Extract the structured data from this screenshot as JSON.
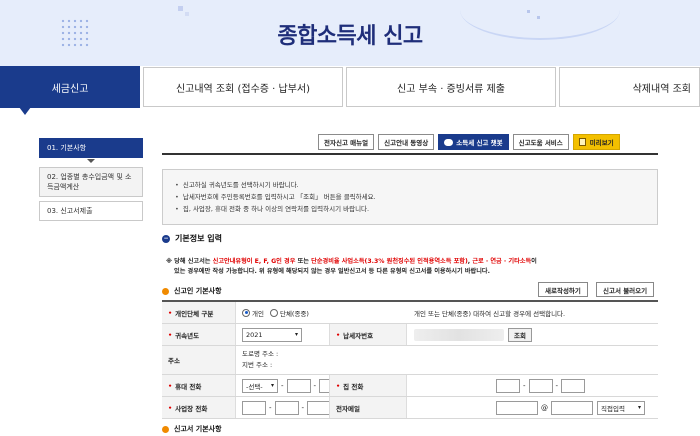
{
  "header": {
    "title": "종합소득세 신고"
  },
  "nav": {
    "tabs": [
      {
        "label": "세금신고",
        "active": true
      },
      {
        "label": "신고내역 조회 (접수증 · 납부서)",
        "active": false
      },
      {
        "label": "신고 부속 · 증빙서류 제출",
        "active": false
      },
      {
        "label": "삭제내역 조회",
        "active": false
      }
    ]
  },
  "steps": [
    {
      "label": "01. 기본사항",
      "state": "active"
    },
    {
      "label": "02. 업종별 총수입금액 및 소득금액계산",
      "state": "normal"
    },
    {
      "label": "03. 신고서제출",
      "state": "current"
    }
  ],
  "toolbar": {
    "manual": "전자신고 매뉴얼",
    "video": "신고안내 동영상",
    "chatbot": "소득세 신고 챗봇",
    "help_service": "신고도움 서비스",
    "preview": "미리보기"
  },
  "notice": [
    "신고하실 귀속년도를 선택하시기 바랍니다.",
    "납세자번호에 주민등록번호를 입력하시고 「조회」 버튼을 클릭하세요.",
    "집, 사업장, 휴대 전화 중 하나 이상의 연락처를 입력하시기 바랍니다."
  ],
  "section_basic": {
    "title": "기본정보 입력"
  },
  "warning": {
    "line1_prefix": "※ 당해 신고서는 ",
    "line1_red1": "신고안내유형이 E, F, G인 경우",
    "line1_mid": " 또는 ",
    "line1_red2": "단순경비율 사업소득(3.3% 원천징수된 인적용역소득 포함)",
    "line1_sep": ", ",
    "line1_red3": "근로 · 연금 · 기타소득",
    "line1_suffix": "이",
    "line2": "있는 경우에만 작성 가능합니다. 위 유형에 해당되지 않는 경우 일반신고서 등 다른 유형의 신고서를 이용하시기 바랍니다."
  },
  "sub_reporter": {
    "title": "신고인 기본사항"
  },
  "buttons": {
    "new_write": "새로작성하기",
    "load": "신고서 불러오기",
    "lookup": "조회"
  },
  "form": {
    "individual_type": {
      "label": "개인단체 구분",
      "options": [
        "개인",
        "단체(종중)"
      ],
      "selected": "개인",
      "note": "개인 또는 단체(종중) 대하여 신고할 경우에 선택합니다."
    },
    "year": {
      "label": "귀속년도",
      "value": "2021"
    },
    "taxpayer_no": {
      "label": "납세자번호"
    },
    "address": {
      "label": "주소",
      "road": "도로명 주소 :",
      "lot": "지번 주소 :"
    },
    "mobile": {
      "label": "휴대 전화",
      "select": "-선택-"
    },
    "home_phone": {
      "label": "집 전화"
    },
    "biz_phone": {
      "label": "사업장 전화"
    },
    "email": {
      "label": "전자메일",
      "at": "@",
      "domain_select": "직접입력"
    }
  },
  "sub_report": {
    "title": "신고서 기본사항"
  }
}
